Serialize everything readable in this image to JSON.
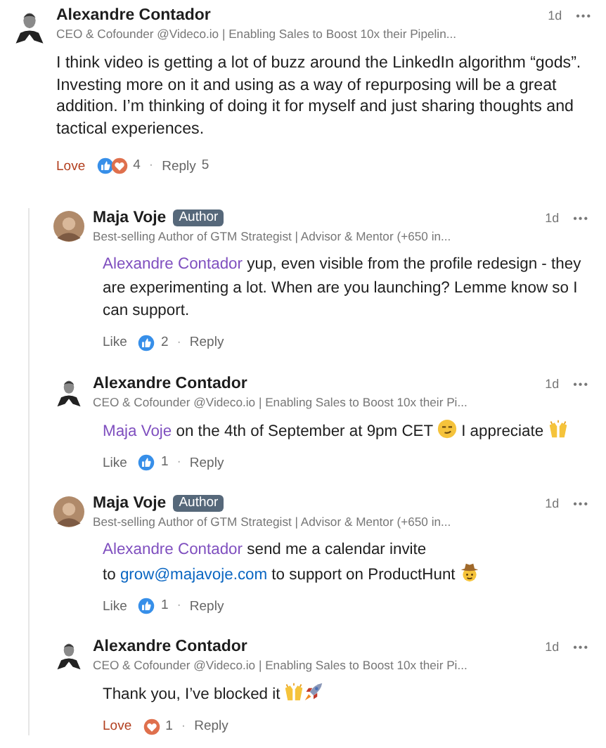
{
  "comment": {
    "author": "Alexandre Contador",
    "avatar": {
      "kind": "silhouette"
    },
    "headline": "CEO & Cofounder @Videco.io | Enabling Sales to Boost 10x their Pipelin...",
    "time": "1d",
    "more": "•••",
    "body": [
      {
        "kind": "text",
        "text": "I think video is getting a lot of buzz around the LinkedIn algorithm “gods”. Investing more on it and using as a way of repurposing will be a great addition. I’m thinking of doing it for myself and just sharing thoughts and tactical experiences."
      }
    ],
    "reaction": {
      "label": "Love",
      "active": true
    },
    "reaction_icons": [
      {
        "kind": "like"
      },
      {
        "kind": "love"
      }
    ],
    "reaction_count": "4",
    "separator": "·",
    "reply_label": "Reply",
    "reply_count": "5"
  },
  "replies": [
    {
      "author": "Maja Voje",
      "avatar": {
        "kind": "photo"
      },
      "badge": "Author",
      "headline": "Best-selling Author of GTM Strategist | Advisor & Mentor (+650 in...",
      "time": "1d",
      "more": "•••",
      "body": [
        {
          "kind": "mention",
          "text": "Alexandre Contador"
        },
        {
          "kind": "text",
          "text": " yup, even visible from the profile redesign - they are experimenting a lot. When are you launching? Lemme know so I can support."
        }
      ],
      "reaction": {
        "label": "Like",
        "active": false
      },
      "reaction_icons": [
        {
          "kind": "like"
        }
      ],
      "reaction_count": "2",
      "separator": "·",
      "reply_label": "Reply"
    },
    {
      "author": "Alexandre Contador",
      "avatar": {
        "kind": "silhouette"
      },
      "headline": "CEO & Cofounder @Videco.io | Enabling Sales to Boost 10x their Pi...",
      "time": "1d",
      "more": "•••",
      "body": [
        {
          "kind": "mention",
          "text": "Maja Voje"
        },
        {
          "kind": "text",
          "text": " on the 4th of September at 9pm CET "
        },
        {
          "kind": "smirk"
        },
        {
          "kind": "text",
          "text": " I appreciate "
        },
        {
          "kind": "hands"
        }
      ],
      "reaction": {
        "label": "Like",
        "active": false
      },
      "reaction_icons": [
        {
          "kind": "like"
        }
      ],
      "reaction_count": "1",
      "separator": "·",
      "reply_label": "Reply"
    },
    {
      "author": "Maja Voje",
      "avatar": {
        "kind": "photo"
      },
      "badge": "Author",
      "headline": "Best-selling Author of GTM Strategist | Advisor & Mentor (+650 in...",
      "time": "1d",
      "more": "•••",
      "body": [
        {
          "kind": "mention",
          "text": "Alexandre Contador"
        },
        {
          "kind": "text",
          "text": " send me a calendar invite"
        },
        {
          "kind": "break"
        },
        {
          "kind": "text",
          "text": "to "
        },
        {
          "kind": "link",
          "text": "grow@majavoje.com"
        },
        {
          "kind": "text",
          "text": " to support on ProductHunt "
        },
        {
          "kind": "cowboy"
        }
      ],
      "reaction": {
        "label": "Like",
        "active": false
      },
      "reaction_icons": [
        {
          "kind": "like"
        }
      ],
      "reaction_count": "1",
      "separator": "·",
      "reply_label": "Reply"
    },
    {
      "author": "Alexandre Contador",
      "avatar": {
        "kind": "silhouette"
      },
      "headline": "CEO & Cofounder @Videco.io | Enabling Sales to Boost 10x their Pi...",
      "time": "1d",
      "more": "•••",
      "body": [
        {
          "kind": "text",
          "text": "Thank you, I’ve blocked it "
        },
        {
          "kind": "hands"
        },
        {
          "kind": "rocket"
        }
      ],
      "reaction": {
        "label": "Love",
        "active": true
      },
      "reaction_icons": [
        {
          "kind": "love"
        }
      ],
      "reaction_count": "1",
      "separator": "·",
      "reply_label": "Reply"
    }
  ]
}
